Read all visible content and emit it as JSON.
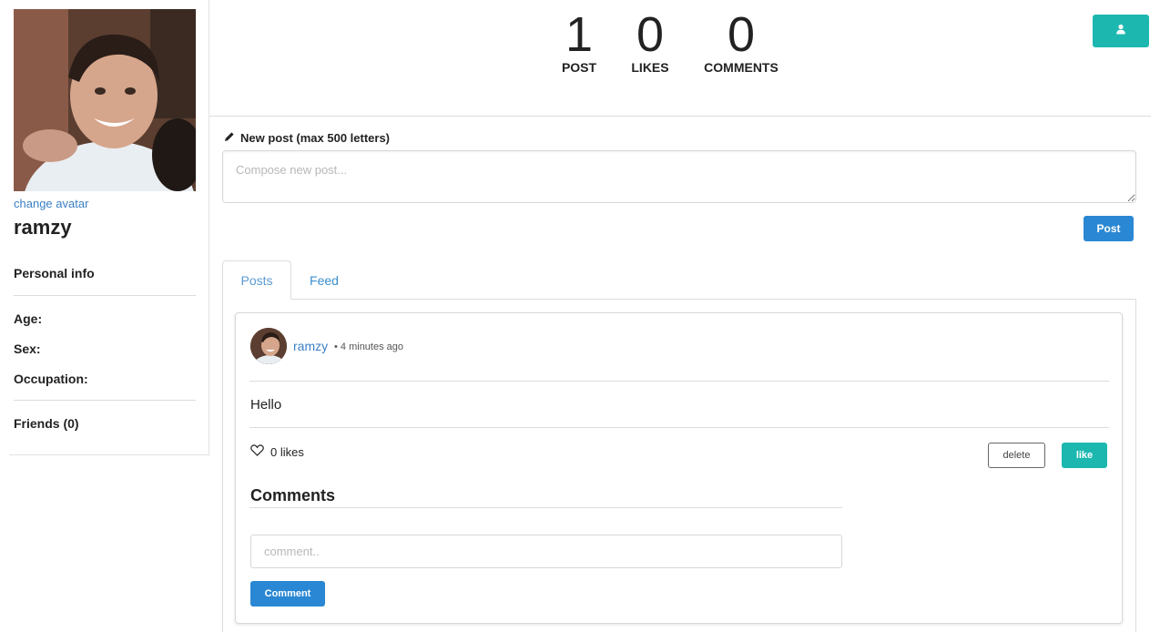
{
  "sidebar": {
    "change_avatar": "change avatar",
    "username": "ramzy",
    "personal_info_heading": "Personal info",
    "fields": {
      "age": "Age:",
      "sex": "Sex:",
      "occupation": "Occupation:"
    },
    "friends": "Friends (0)"
  },
  "stats": {
    "post": {
      "value": "1",
      "label": "POST"
    },
    "likes": {
      "value": "0",
      "label": "LIKES"
    },
    "comments": {
      "value": "0",
      "label": "COMMENTS"
    }
  },
  "header": {
    "profile_button_icon": "user-icon"
  },
  "new_post": {
    "label": "New post (max 500 letters)",
    "label_icon": "pencil-icon",
    "placeholder": "Compose new post...",
    "submit_label": "Post"
  },
  "tabs": [
    {
      "label": "Posts",
      "active": true
    },
    {
      "label": "Feed",
      "active": false
    }
  ],
  "post": {
    "author": "ramzy",
    "time": "• 4 minutes ago",
    "body": "Hello",
    "likes_text": "0 likes",
    "likes_icon": "heart-outline-icon",
    "delete_label": "delete",
    "like_label": "like",
    "comments_heading": "Comments",
    "comment_placeholder": "comment..",
    "comment_button": "Comment"
  },
  "colors": {
    "accent_teal": "#1cb8b0",
    "accent_blue": "#2a87d3",
    "link_blue": "#3a7fc4"
  }
}
